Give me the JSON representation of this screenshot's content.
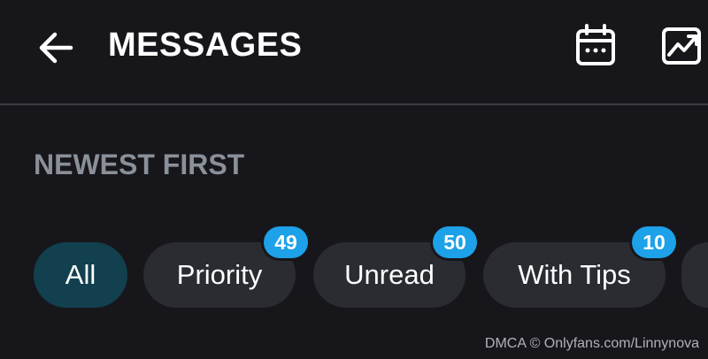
{
  "header": {
    "title": "MESSAGES",
    "back_icon": "arrow-left-icon",
    "calendar_icon": "calendar-icon",
    "stats_icon": "statistics-chart-icon"
  },
  "sort": {
    "label": "NEWEST FIRST"
  },
  "filters": [
    {
      "label": "All",
      "active": true,
      "badge": null
    },
    {
      "label": "Priority",
      "active": false,
      "badge": "49"
    },
    {
      "label": "Unread",
      "active": false,
      "badge": "50"
    },
    {
      "label": "With Tips",
      "active": false,
      "badge": "10"
    }
  ],
  "watermark": {
    "text": "DMCA © Onlyfans.com/Linnynova"
  },
  "colors": {
    "background": "#17171b",
    "chip": "#2a2c31",
    "chip_active": "#12404f",
    "badge": "#1da1e8",
    "muted_text": "#8a9099"
  }
}
